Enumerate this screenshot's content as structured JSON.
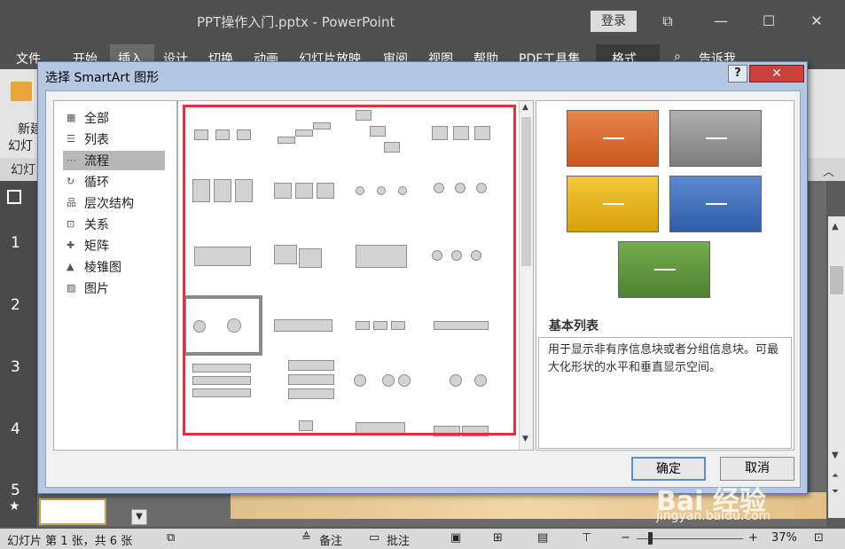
{
  "window": {
    "title": "PPT操作入门.pptx - PowerPoint",
    "login": "登录"
  },
  "ribbon": {
    "tabs": [
      "文件",
      "开始",
      "插入",
      "设计",
      "切换",
      "动画",
      "幻灯片放映",
      "审阅",
      "视图",
      "帮助",
      "PDF工具集",
      "格式",
      "告诉我"
    ],
    "new_slide": "新建",
    "slide_word": "幻灯",
    "group_label": "幻灯"
  },
  "slides": {
    "numbers": [
      "1",
      "2",
      "3",
      "4",
      "5"
    ]
  },
  "dialog": {
    "title": "选择 SmartArt 图形",
    "help": "?",
    "close": "✕",
    "categories": [
      {
        "label": "全部",
        "icon": "grid-all-icon"
      },
      {
        "label": "列表",
        "icon": "list-icon"
      },
      {
        "label": "流程",
        "icon": "process-icon"
      },
      {
        "label": "循环",
        "icon": "cycle-icon"
      },
      {
        "label": "层次结构",
        "icon": "hierarchy-icon"
      },
      {
        "label": "关系",
        "icon": "relationship-icon"
      },
      {
        "label": "矩阵",
        "icon": "matrix-icon"
      },
      {
        "label": "棱锥图",
        "icon": "pyramid-icon"
      },
      {
        "label": "图片",
        "icon": "picture-icon"
      }
    ],
    "selected_category": "流程",
    "preview": {
      "title": "基本列表",
      "description": "用于显示非有序信息块或者分组信息块。可最大化形状的水平和垂直显示空间。",
      "colors": [
        "#d9682a",
        "#8f8f8f",
        "#e6b413",
        "#3e6fb8",
        "#5b9337"
      ]
    },
    "ok": "确定",
    "cancel": "取消"
  },
  "statusbar": {
    "slide_info": "幻灯片 第 1 张，共 6 张",
    "notes": "备注",
    "comments": "批注",
    "zoom": "37%",
    "zoom_minus": "−",
    "zoom_plus": "+"
  },
  "watermark": {
    "brand": "Bai 经验",
    "url": "jingyan.baidu.com"
  }
}
